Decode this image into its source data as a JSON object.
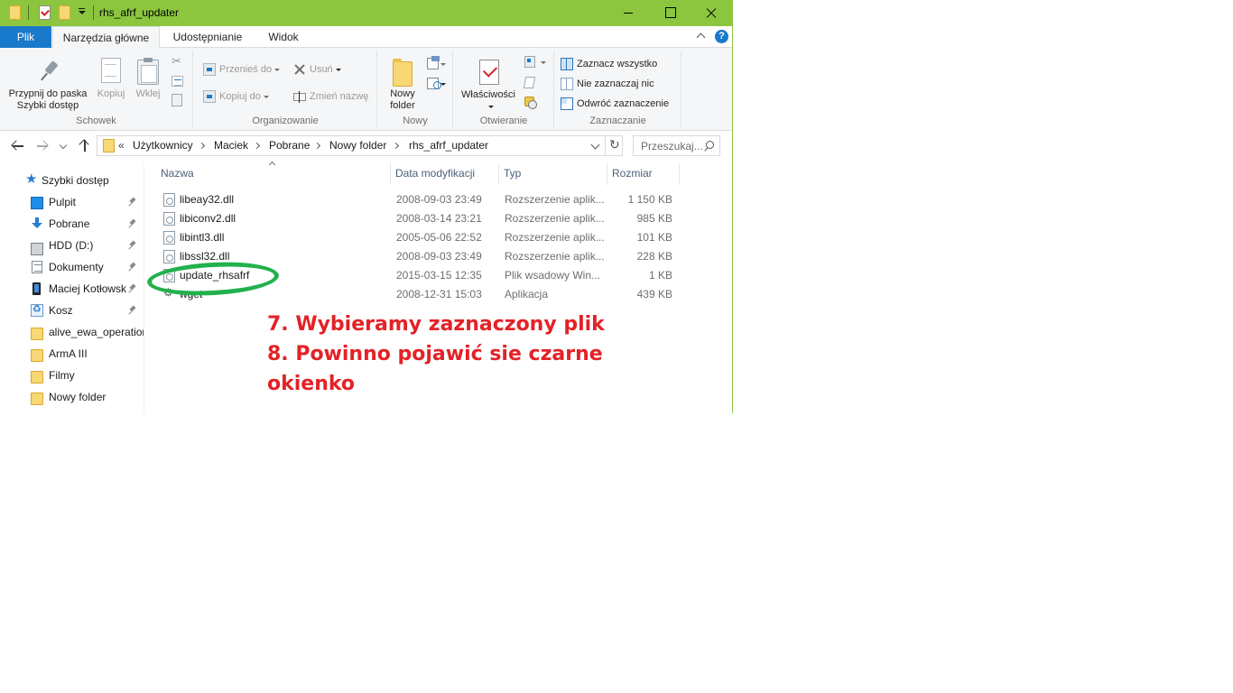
{
  "window": {
    "title": "rhs_afrf_updater"
  },
  "ribbon_tabs": {
    "file": "Plik",
    "home": "Narzędzia główne",
    "share": "Udostępnianie",
    "view": "Widok",
    "help": "?"
  },
  "ribbon": {
    "clipboard": {
      "pin": "Przypnij do paska\nSzybki dostęp",
      "copy": "Kopiuj",
      "paste": "Wklej",
      "label": "Schowek"
    },
    "organize": {
      "move_to": "Przenieś do",
      "copy_to": "Kopiuj do",
      "delete": "Usuń",
      "rename": "Zmień nazwę",
      "label": "Organizowanie"
    },
    "new": {
      "new_folder": "Nowy\nfolder",
      "label": "Nowy"
    },
    "open": {
      "properties": "Właściwości",
      "label": "Otwieranie"
    },
    "select": {
      "select_all": "Zaznacz wszystko",
      "select_none": "Nie zaznaczaj nic",
      "invert": "Odwróć zaznaczenie",
      "label": "Zaznaczanie"
    }
  },
  "address": {
    "overflow": "«",
    "crumbs": [
      "Użytkownicy",
      "Maciek",
      "Pobrane",
      "Nowy folder",
      "rhs_afrf_updater"
    ]
  },
  "search": {
    "placeholder": "Przeszukaj..."
  },
  "nav_pane": {
    "quick_access": "Szybki dostęp",
    "items": [
      {
        "label": "Pulpit",
        "icon": "desktop-icon",
        "pinned": true
      },
      {
        "label": "Pobrane",
        "icon": "download-icon",
        "pinned": true
      },
      {
        "label": "HDD (D:)",
        "icon": "drive-icon",
        "pinned": true
      },
      {
        "label": "Dokumenty",
        "icon": "documents-icon",
        "pinned": true
      },
      {
        "label": "Maciej Kotłowsk",
        "icon": "phone-icon",
        "pinned": true
      },
      {
        "label": "Kosz",
        "icon": "recycle-bin-icon",
        "pinned": true
      },
      {
        "label": "alive_ewa_operatior",
        "icon": "folder-icon",
        "pinned": false
      },
      {
        "label": "ArmA III",
        "icon": "folder-icon",
        "pinned": false
      },
      {
        "label": "Filmy",
        "icon": "folder-icon",
        "pinned": false
      },
      {
        "label": "Nowy folder",
        "icon": "folder-icon",
        "pinned": false
      }
    ]
  },
  "file_list": {
    "columns": {
      "name": "Nazwa",
      "date": "Data modyfikacji",
      "type": "Typ",
      "size": "Rozmiar"
    },
    "rows": [
      {
        "name": "libeay32.dll",
        "date": "2008-09-03 23:49",
        "type": "Rozszerzenie aplik...",
        "size": "1 150 KB",
        "icon": "dll-file-icon"
      },
      {
        "name": "libiconv2.dll",
        "date": "2008-03-14 23:21",
        "type": "Rozszerzenie aplik...",
        "size": "985 KB",
        "icon": "dll-file-icon"
      },
      {
        "name": "libintl3.dll",
        "date": "2005-05-06 22:52",
        "type": "Rozszerzenie aplik...",
        "size": "101 KB",
        "icon": "dll-file-icon"
      },
      {
        "name": "libssl32.dll",
        "date": "2008-09-03 23:49",
        "type": "Rozszerzenie aplik...",
        "size": "228 KB",
        "icon": "dll-file-icon"
      },
      {
        "name": "update_rhsafrf",
        "date": "2015-03-15 12:35",
        "type": "Plik wsadowy Win...",
        "size": "1 KB",
        "icon": "batch-file-icon"
      },
      {
        "name": "wget",
        "date": "2008-12-31 15:03",
        "type": "Aplikacja",
        "size": "439 KB",
        "icon": "application-icon"
      }
    ]
  },
  "annotation": {
    "line1": "7. Wybieramy zaznaczony plik",
    "line2": "8. Powinno pojawić sie czarne",
    "line3": "okienko",
    "highlight_color": "#22b14c",
    "text_color": "#e32227"
  },
  "colors": {
    "title_bar": "#8cc63f",
    "file_tab": "#1979ca"
  }
}
